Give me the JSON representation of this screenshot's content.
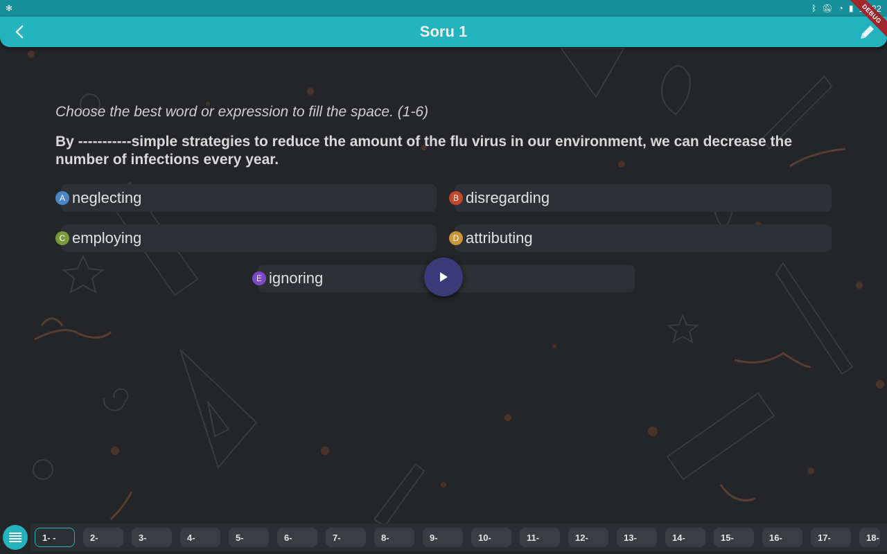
{
  "status": {
    "time": "14:22"
  },
  "header": {
    "title": "Soru 1",
    "debug_label": "DEBUG"
  },
  "question": {
    "instruction": "Choose the best word or expression to fill the space. (1-6)",
    "stem": "By -----------simple strategies to reduce the amount of the flu virus in our environment, we can decrease the number of infections every year."
  },
  "options": [
    {
      "letter": "A",
      "text": "neglecting",
      "color": "#4a86c5"
    },
    {
      "letter": "B",
      "text": "disregarding",
      "color": "#c2482c"
    },
    {
      "letter": "C",
      "text": "employing",
      "color": "#7a9a3a"
    },
    {
      "letter": "D",
      "text": "attributing",
      "color": "#c9963a"
    },
    {
      "letter": "E",
      "text": "ignoring",
      "color": "#7b48c8"
    }
  ],
  "nav": {
    "items": [
      "1-  -",
      "2-",
      "3-",
      "4-",
      "5-",
      "6-",
      "7-",
      "8-",
      "9-",
      "10-",
      "11-",
      "12-",
      "13-",
      "14-",
      "15-",
      "16-",
      "17-",
      "18-"
    ]
  },
  "colors": {
    "accent": "#22b3bf",
    "statusbar": "#178f9a",
    "background": "#232528"
  }
}
